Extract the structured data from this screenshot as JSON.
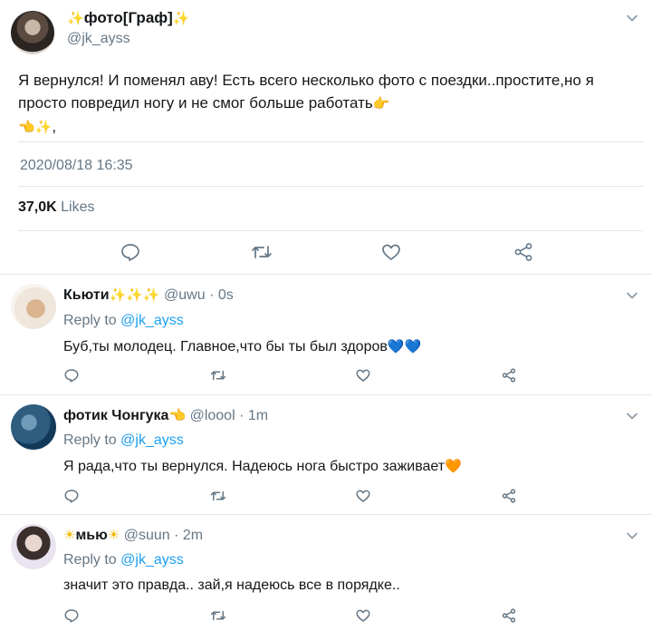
{
  "tweet": {
    "author_name": "фото[Граф]",
    "author_handle": "@jk_ayss",
    "text": "Я вернулся! И поменял аву! Есть всего несколько фото с поездки..простите,но я просто повредил ногу и не смог больше работать",
    "text_end": ",",
    "date": "2020/08/18 16:35",
    "likes_count": "37,0K",
    "likes_label": "Likes"
  },
  "replies": [
    {
      "name": "Кьюти",
      "handle": "@uwu",
      "time": "· 0s",
      "reply_prefix": "Reply to",
      "reply_handle": "@jk_ayss",
      "text": "Буб,ты молодец. Главное,что бы ты был здоров"
    },
    {
      "name": "фотик Чонгука",
      "handle": "@loool",
      "time": "· 1m",
      "reply_prefix": "Reply to",
      "reply_handle": "@jk_ayss",
      "text": "Я рада,что ты вернулся. Надеюсь нога быстро заживает"
    },
    {
      "name": "мью",
      "handle": "@suun",
      "time": "· 2m",
      "reply_prefix": "Reply to",
      "reply_handle": "@jk_ayss",
      "text": "значит это правда.. зай,я надеюсь все в порядке.."
    }
  ],
  "colors": {
    "link": "#1da1f2",
    "meta": "#657786",
    "separator": "#e1e8ed"
  },
  "icons": [
    "sparkle-icon",
    "pointing-hand-icon",
    "blue-heart-icon",
    "orange-heart-icon",
    "sun-icon",
    "reply-icon",
    "retweet-icon",
    "like-icon",
    "share-icon",
    "chevron-down-icon"
  ]
}
